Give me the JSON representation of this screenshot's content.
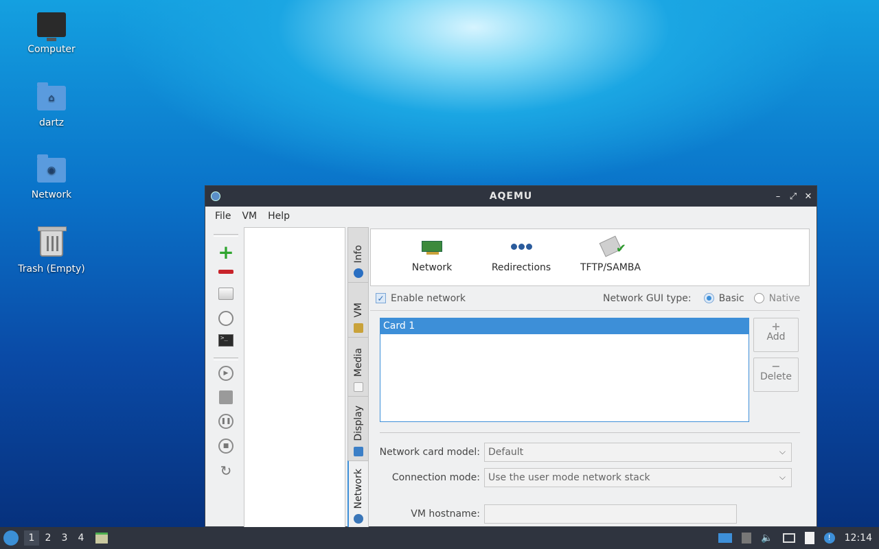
{
  "desktop": {
    "icons": [
      {
        "label": "Computer",
        "icon": "computer-icon"
      },
      {
        "label": "dartz",
        "icon": "home-folder-icon"
      },
      {
        "label": "Network",
        "icon": "network-folder-icon"
      },
      {
        "label": "Trash (Empty)",
        "icon": "trash-icon"
      }
    ]
  },
  "window": {
    "title": "AQEMU",
    "controls": {
      "minimize": "–",
      "maximize": "⤢",
      "close": "✕"
    },
    "menu": [
      "File",
      "VM",
      "Help"
    ],
    "side_tabs": [
      "Info",
      "VM",
      "Media",
      "Display",
      "Network"
    ],
    "active_tab": "Network",
    "pages": [
      "Network",
      "Redirections",
      "TFTP/SAMBA"
    ],
    "enable_network": {
      "label": "Enable network",
      "checked": true
    },
    "gui_type": {
      "label": "Network GUI type:",
      "options": [
        "Basic",
        "Native"
      ],
      "selected": "Basic"
    },
    "cards": [
      "Card 1"
    ],
    "add_button": {
      "symbol": "+",
      "label": "Add"
    },
    "delete_button": {
      "symbol": "−",
      "label": "Delete"
    },
    "card_model": {
      "label": "Network card model:",
      "value": "Default"
    },
    "connection_mode": {
      "label": "Connection mode:",
      "value": "Use the user mode network stack"
    },
    "hostname": {
      "label": "VM hostname:",
      "value": ""
    }
  },
  "taskbar": {
    "workspaces": [
      "1",
      "2",
      "3",
      "4"
    ],
    "active_workspace": "1",
    "clock": "12:14"
  },
  "colors": {
    "accent": "#3d8fd8",
    "panel": "#2f343f",
    "window_bg": "#eff0f1"
  }
}
